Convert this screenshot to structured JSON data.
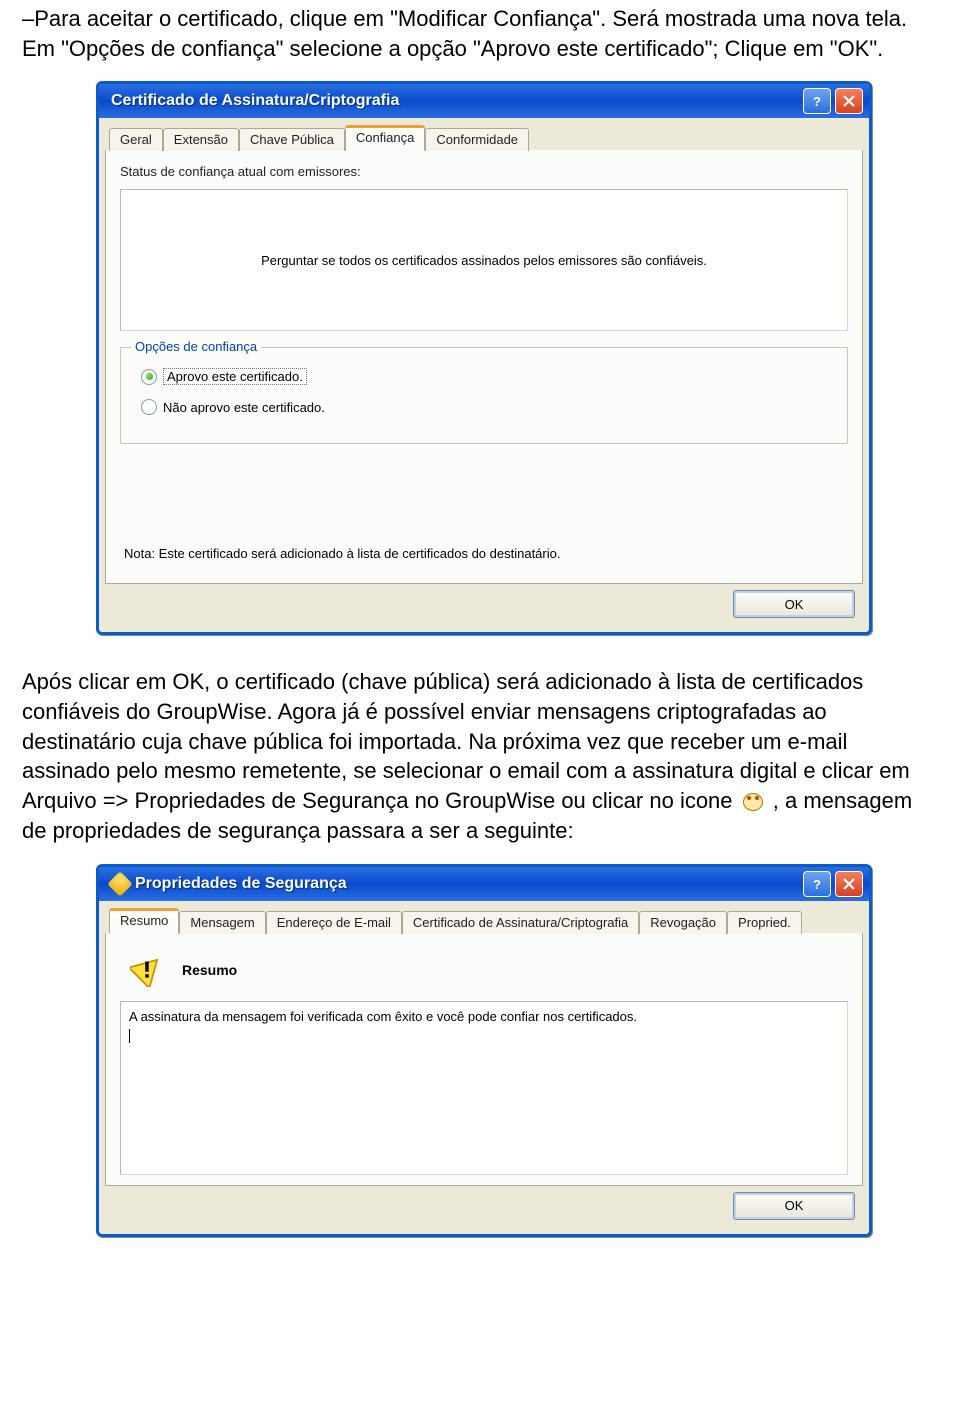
{
  "doc": {
    "para1": "–Para aceitar o certificado, clique em \"Modificar Confiança\". Será mostrada uma nova tela. Em \"Opções de confiança\" selecione a opção \"Aprovo este certificado\"; Clique em \"OK\".",
    "para2": "Após clicar em OK, o certificado (chave pública) será adicionado à lista de certificados confiáveis do GroupWise. Agora já é possível enviar mensagens criptografadas ao destinatário cuja chave pública foi importada. Na próxima vez que receber um e-mail assinado pelo mesmo remetente, se selecionar o email com a assinatura digital e clicar em Arquivo => Propriedades de Segurança no GroupWise ou clicar no icone ",
    "para2b": " , a mensagem de propriedades de segurança passara a ser a seguinte:"
  },
  "dialog1": {
    "title": "Certificado de Assinatura/Criptografia",
    "tabs": [
      "Geral",
      "Extensão",
      "Chave Pública",
      "Confiança",
      "Conformidade"
    ],
    "status_label": "Status de confiança atual com emissores:",
    "status_msg": "Perguntar se todos os certificados assinados pelos emissores são confiáveis.",
    "group_title": "Opções de confiança",
    "opt_approve": "Aprovo este certificado.",
    "opt_reject": "Não aprovo este certificado.",
    "note": "Nota: Este certificado será adicionado à lista de certificados do destinatário.",
    "ok": "OK"
  },
  "dialog2": {
    "title": "Propriedades de Segurança",
    "tabs": [
      "Resumo",
      "Mensagem",
      "Endereço de E-mail",
      "Certificado de Assinatura/Criptografia",
      "Revogação",
      "Propried."
    ],
    "section_title": "Resumo",
    "body_text": "A assinatura da mensagem foi verificada com êxito e você pode confiar nos certificados.",
    "ok": "OK"
  }
}
